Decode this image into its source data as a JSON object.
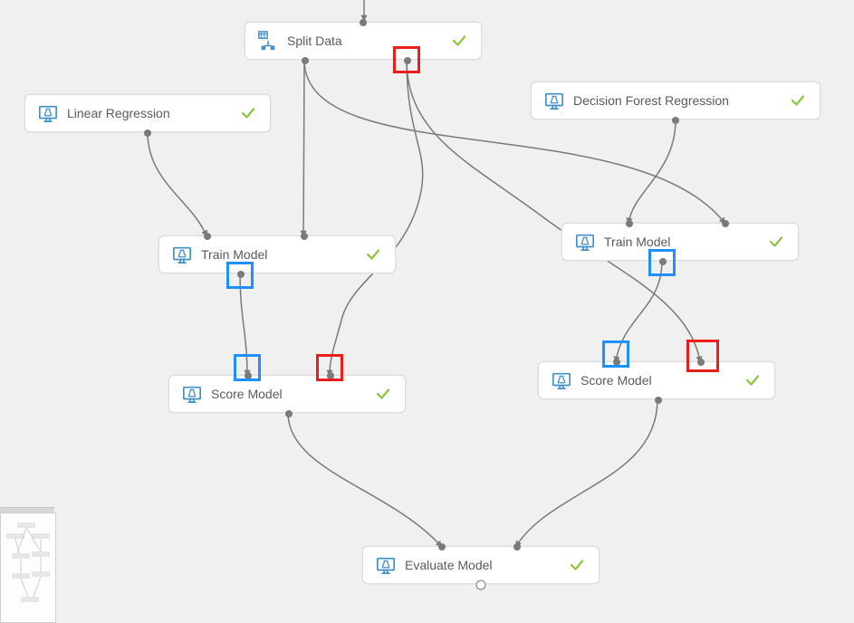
{
  "nodes": {
    "split": {
      "label": "Split Data",
      "icon": "data-split-icon",
      "status": "ok"
    },
    "lr": {
      "label": "Linear Regression",
      "icon": "experiment-icon",
      "status": "ok"
    },
    "dfr": {
      "label": "Decision Forest Regression",
      "icon": "experiment-icon",
      "status": "ok"
    },
    "train1": {
      "label": "Train Model",
      "icon": "experiment-icon",
      "status": "ok"
    },
    "train2": {
      "label": "Train Model",
      "icon": "experiment-icon",
      "status": "ok"
    },
    "score1": {
      "label": "Score Model",
      "icon": "experiment-icon",
      "status": "ok"
    },
    "score2": {
      "label": "Score Model",
      "icon": "experiment-icon",
      "status": "ok"
    },
    "eval": {
      "label": "Evaluate Model",
      "icon": "experiment-icon",
      "status": "ok"
    }
  },
  "highlights": [
    {
      "color": "red",
      "target": "split.out.right"
    },
    {
      "color": "blue",
      "target": "train1.out"
    },
    {
      "color": "blue",
      "target": "score1.in.left"
    },
    {
      "color": "red",
      "target": "score1.in.right"
    },
    {
      "color": "blue",
      "target": "train2.out"
    },
    {
      "color": "blue",
      "target": "score2.in.left"
    },
    {
      "color": "red",
      "target": "score2.in.right"
    }
  ],
  "colors": {
    "highlight_red": "#ef1c1c",
    "highlight_blue": "#1e90ff",
    "ok_green": "#8cc63f",
    "icon_blue": "#3f8fc9",
    "edge_gray": "#7a7a7a"
  }
}
